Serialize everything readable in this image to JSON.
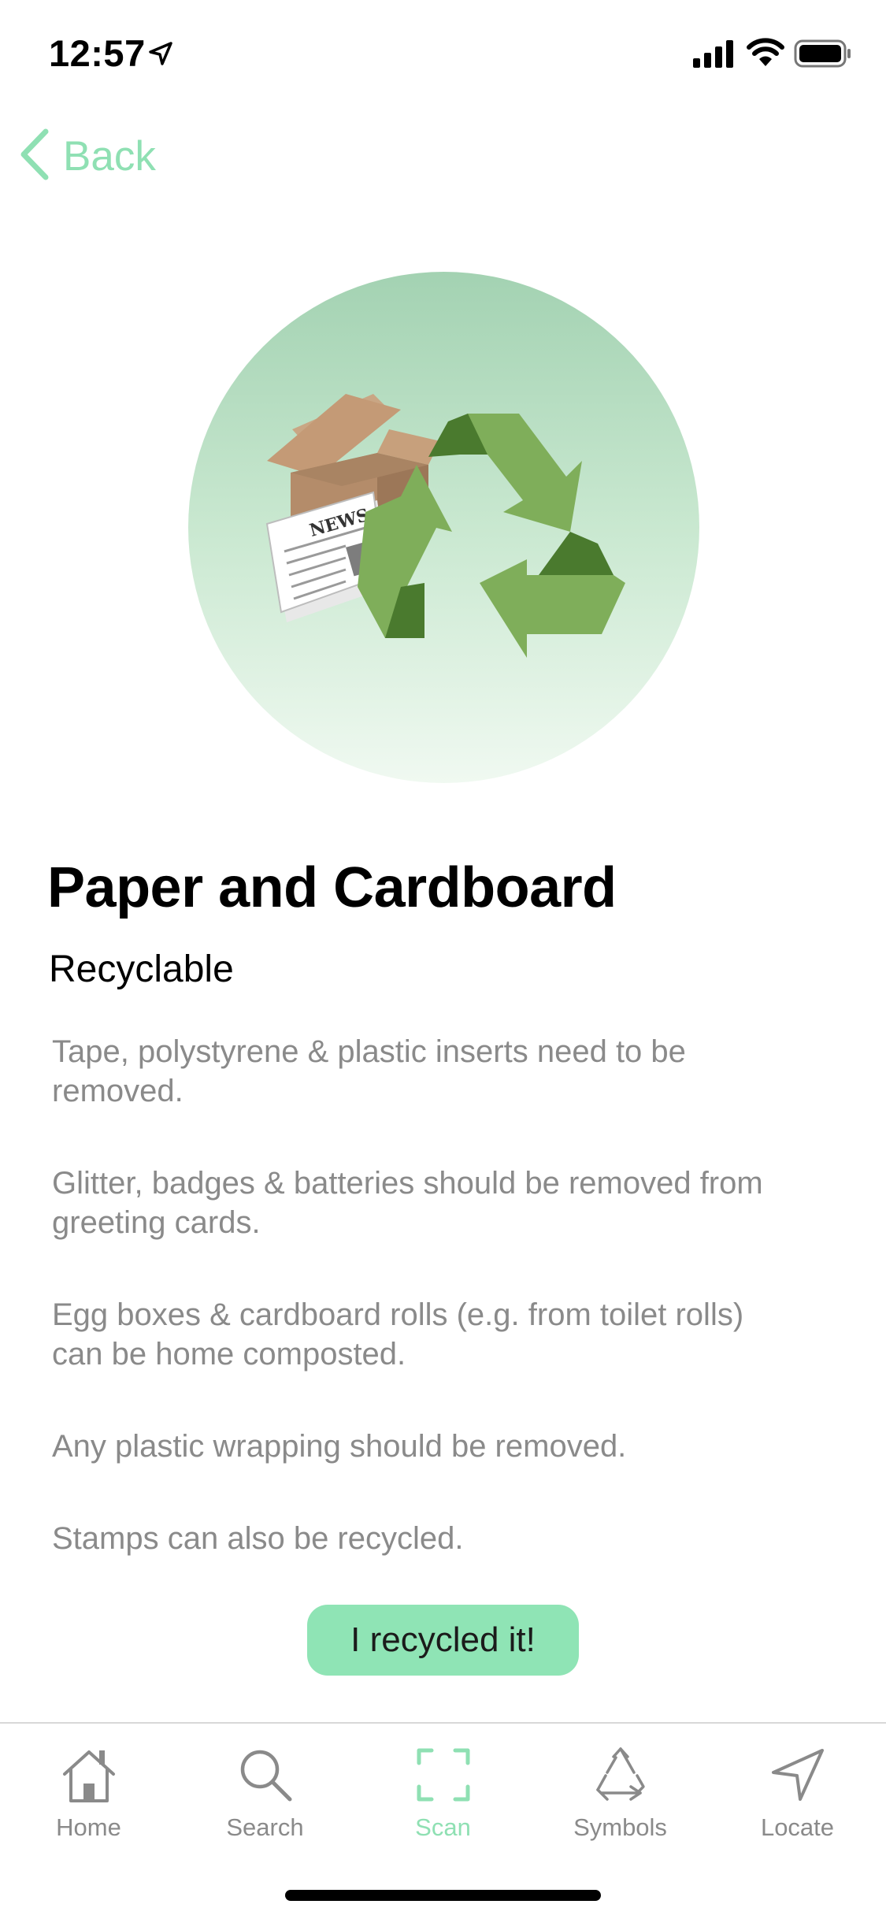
{
  "status_bar": {
    "time": "12:57",
    "icons": [
      "location-arrow-icon",
      "signal-icon",
      "wifi-icon",
      "battery-icon"
    ]
  },
  "nav": {
    "back_label": "Back",
    "back_icon": "chevron-left-icon"
  },
  "hero": {
    "illustration": "paper-cardboard-recycling-illustration",
    "newspaper_text": "NEWS"
  },
  "item": {
    "title": "Paper and Cardboard",
    "status": "Recyclable",
    "notes": [
      "Tape, polystyrene & plastic inserts need to be removed.",
      "Glitter, badges & batteries should be removed from greeting cards.",
      "Egg boxes & cardboard rolls (e.g. from toilet rolls) can be home composted.",
      "Any plastic wrapping should be removed.",
      "Stamps can also be recycled."
    ]
  },
  "action": {
    "recycle_label": "I recycled it!"
  },
  "tab_bar": {
    "active": "Scan",
    "tabs": [
      {
        "label": "Home",
        "icon": "home-icon"
      },
      {
        "label": "Search",
        "icon": "search-icon"
      },
      {
        "label": "Scan",
        "icon": "scan-icon"
      },
      {
        "label": "Symbols",
        "icon": "recycle-symbol-icon"
      },
      {
        "label": "Locate",
        "icon": "navigation-arrow-icon"
      }
    ]
  },
  "colors": {
    "accent": "#8fe0b3",
    "button": "#8fe4b5",
    "muted_text": "#8a8a8a",
    "recycle_green": "#7fae5a",
    "recycle_dark_green": "#4a7a2e"
  }
}
